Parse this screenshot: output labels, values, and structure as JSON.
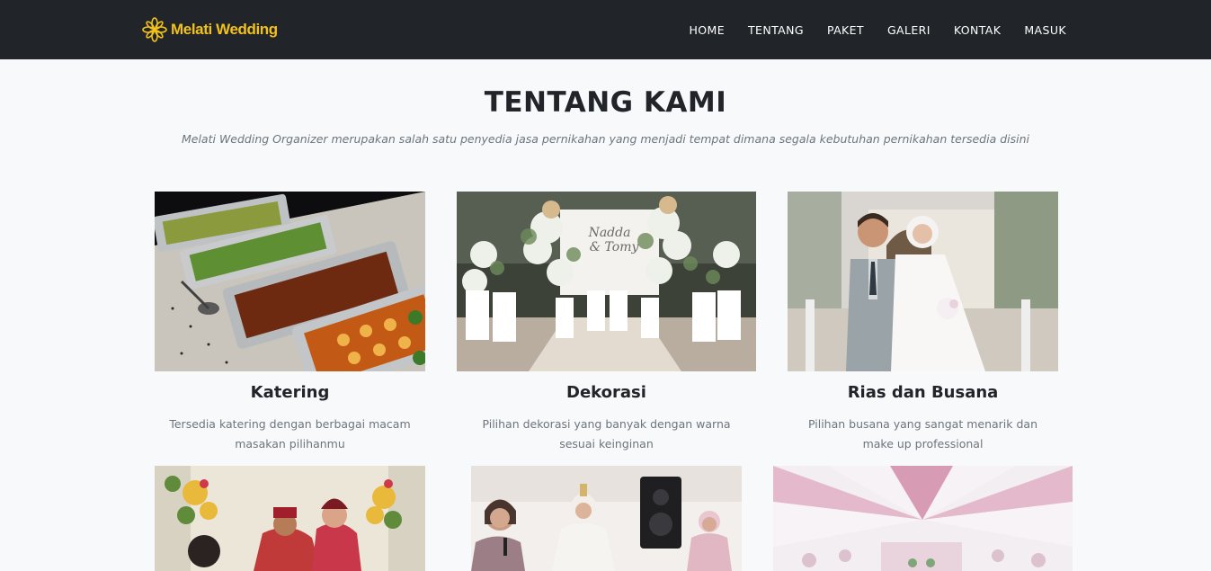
{
  "brand": {
    "name": "Melati Wedding",
    "logo_icon": "flower-icon",
    "color": "#f2c21b"
  },
  "nav": {
    "items": [
      "HOME",
      "TENTANG",
      "PAKET",
      "GALERI",
      "KONTAK",
      "MASUK"
    ]
  },
  "about": {
    "title": "TENTANG KAMI",
    "subtitle": "Melati Wedding Organizer merupakan salah satu penyedia jasa pernikahan yang menjadi tempat dimana segala kebutuhan pernikahan tersedia disini"
  },
  "services": [
    {
      "title": "Katering",
      "text": "Tersedia katering dengan berbagai macam masakan pilihanmu",
      "image": "catering-buffet-photo"
    },
    {
      "title": "Dekorasi",
      "text": "Pilihan dekorasi yang banyak dengan warna sesuai keinginan",
      "image": "wedding-decoration-photo"
    },
    {
      "title": "Rias dan Busana",
      "text": "Pilihan busana yang sangat menarik dan make up professional",
      "image": "bride-groom-photo"
    },
    {
      "image": "traditional-ceremony-photo"
    },
    {
      "image": "singers-entertainment-photo"
    },
    {
      "image": "pink-tent-venue-photo"
    }
  ],
  "colors": {
    "navbar": "#212529",
    "background": "#f8f9fa",
    "muted_text": "#6c757d"
  }
}
